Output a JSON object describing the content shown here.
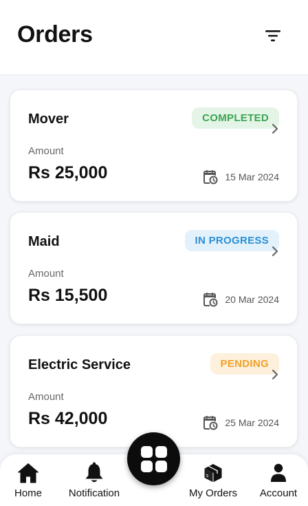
{
  "header": {
    "title": "Orders",
    "filter_icon": "filter-icon"
  },
  "orders": [
    {
      "title": "Mover",
      "status": "COMPLETED",
      "status_color": "#3aa552",
      "amount_label": "Amount",
      "amount": "Rs 25,000",
      "date": "15 Mar 2024"
    },
    {
      "title": "Maid",
      "status": "IN PROGRESS",
      "status_color": "#2b8fd3",
      "amount_label": "Amount",
      "amount": "Rs 15,500",
      "date": "20 Mar 2024"
    },
    {
      "title": "Electric Service",
      "status": "PENDING",
      "status_color": "#f0a02a",
      "amount_label": "Amount",
      "amount": "Rs 42,000",
      "date": "25 Mar 2024"
    }
  ],
  "nav": {
    "items": [
      {
        "label": "Home",
        "icon": "home-icon"
      },
      {
        "label": "Notification",
        "icon": "bell-icon"
      },
      {
        "label": "My Orders",
        "icon": "package-icon"
      },
      {
        "label": "Account",
        "icon": "person-icon"
      }
    ],
    "center_icon": "grid-icon"
  }
}
